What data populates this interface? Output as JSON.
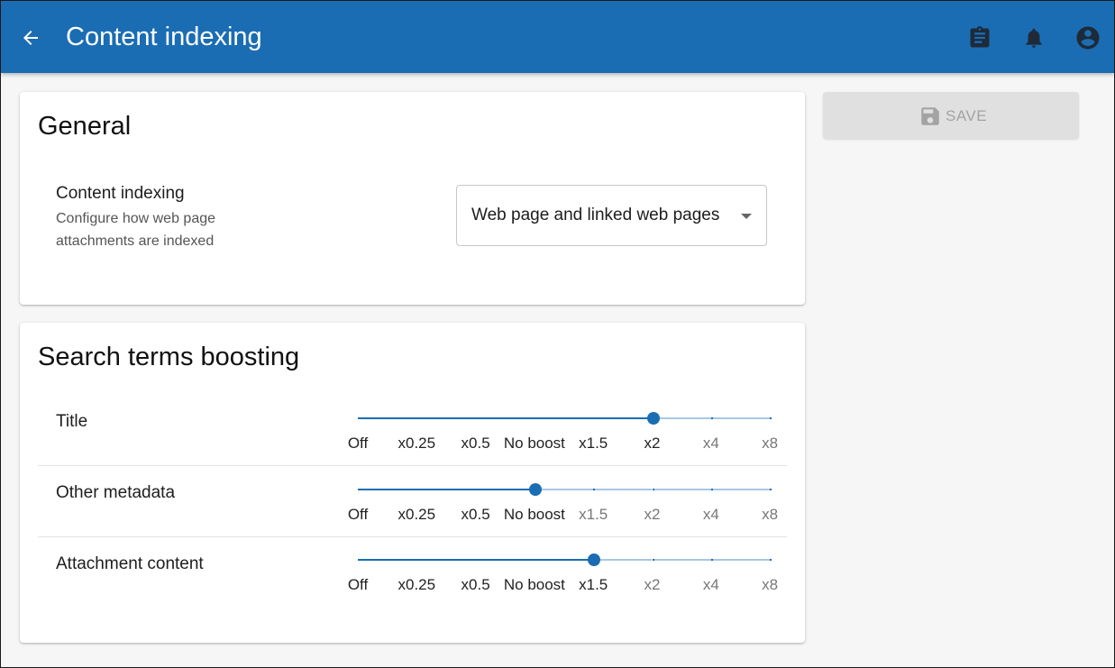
{
  "app": {
    "title": "Content indexing"
  },
  "appbar": {
    "icons": [
      "arrow-left-icon",
      "clipboard-icon",
      "bell-icon",
      "account-circle-icon"
    ],
    "color": "#1a6db3"
  },
  "general": {
    "title": "General",
    "setting": {
      "label": "Content indexing",
      "description": "Configure how web page attachments are indexed",
      "selected_value": "Web page and linked web pages"
    }
  },
  "boosting": {
    "title": "Search terms boosting",
    "scale": [
      "Off",
      "x0.25",
      "x0.5",
      "No boost",
      "x1.5",
      "x2",
      "x4",
      "x8"
    ],
    "rows": [
      {
        "label": "Title",
        "selected": "x2",
        "selected_index": 5
      },
      {
        "label": "Other metadata",
        "selected": "No boost",
        "selected_index": 3
      },
      {
        "label": "Attachment content",
        "selected": "x1.5",
        "selected_index": 4
      }
    ]
  },
  "actions": {
    "save_label": "SAVE",
    "save_enabled": false
  },
  "colors": {
    "accent": "#1a6db3",
    "track_inactive": "#a9c6e4",
    "disabled_button": "#e0e0e0"
  }
}
